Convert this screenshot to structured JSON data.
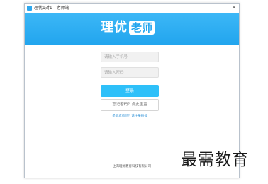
{
  "window": {
    "title": "理优1对1 - 老师端",
    "minimize_glyph": "—",
    "close_glyph": "✕"
  },
  "header": {
    "logo_main": "理优",
    "logo_tag": "老师",
    "background_color": "#2ab0f2"
  },
  "form": {
    "phone_placeholder": "请输入手机号",
    "password_placeholder": "请输入密码",
    "login_label": "登录",
    "forgot_label": "忘记密码？点此重置",
    "register_link": "是新老师吗？请注册账号"
  },
  "footer": {
    "company": "上海理优教育科技有限公司"
  },
  "watermark": {
    "text": "最需教育"
  }
}
